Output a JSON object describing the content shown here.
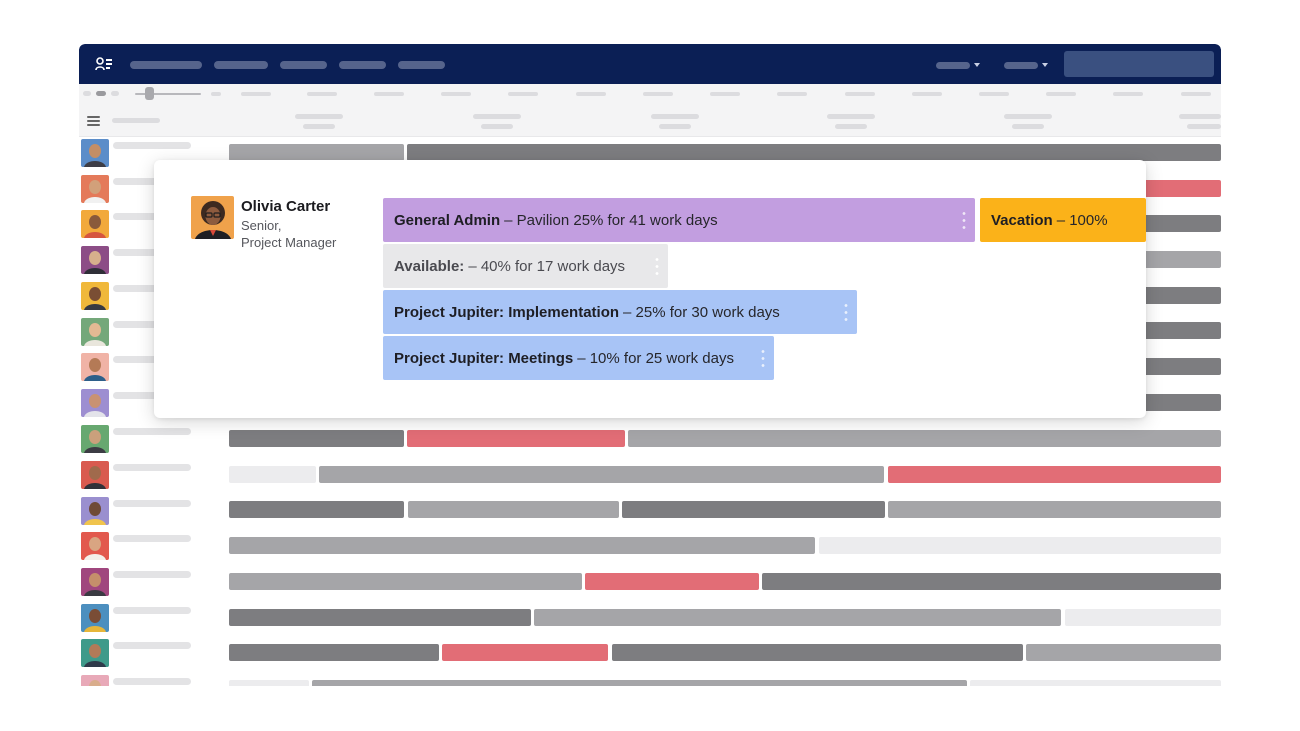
{
  "colors": {
    "nav_bg": "#0b1f55",
    "general_admin": "#c29ee0",
    "vacation": "#fbb219",
    "available": "#e8e8ea",
    "project": "#a8c4f6",
    "time_off": "#e26d76"
  },
  "icons": {
    "logo": "people-list-icon",
    "menu": "hamburger-menu-icon",
    "drag": "drag-handle-icon"
  },
  "person": {
    "name": "Olivia Carter",
    "title_line1": "Senior,",
    "title_line2": "Project Manager"
  },
  "allocations": [
    {
      "name": "General Admin",
      "detail": "– Pavilion 25% for 41 work days"
    },
    {
      "name": "Vacation",
      "detail": "– 100%"
    },
    {
      "name": "Available:",
      "detail": "– 40% for 17 work days"
    },
    {
      "name": "Project Jupiter: Implementation",
      "detail": "– 25% for 30 work days"
    },
    {
      "name": "Project Jupiter: Meetings",
      "detail": "– 10% for 25 work days"
    }
  ]
}
